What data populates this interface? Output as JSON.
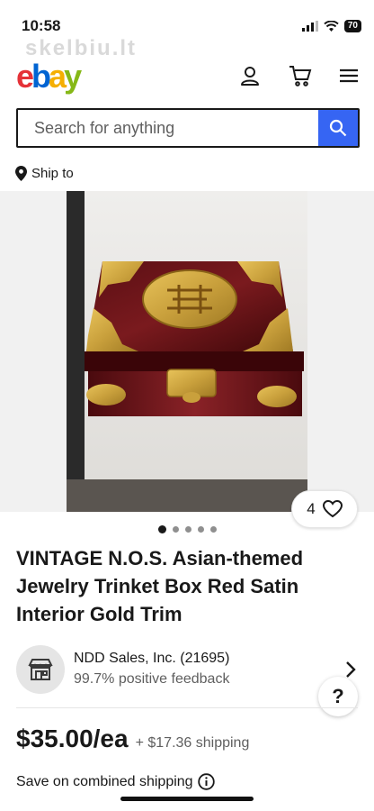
{
  "status_bar": {
    "time": "10:58",
    "battery": "70"
  },
  "watermark": "skelbiu.lt",
  "header": {
    "logo_letters": [
      "e",
      "b",
      "a",
      "y"
    ]
  },
  "search": {
    "placeholder": "Search for anything",
    "value": ""
  },
  "ship_to": {
    "label": "Ship to"
  },
  "gallery": {
    "watch_count": "4",
    "total_images": 5,
    "active_image_index": 1
  },
  "listing": {
    "title": "VINTAGE N.O.S. Asian-themed Jewelry Trinket Box Red Satin Interior Gold Trim"
  },
  "seller": {
    "name": "NDD Sales, Inc. (21695)",
    "feedback": "99.7% positive feedback"
  },
  "help": {
    "label": "?"
  },
  "pricing": {
    "price": "$35.00/ea",
    "shipping": "+ $17.36 shipping",
    "combined_shipping": "Save on combined shipping"
  },
  "colors": {
    "ebay_red": "#e53238",
    "ebay_blue": "#0064d2",
    "ebay_yellow": "#f5af02",
    "ebay_green": "#86b817",
    "search_button": "#3665f3",
    "text": "#191919",
    "muted": "#5f5f5f"
  }
}
